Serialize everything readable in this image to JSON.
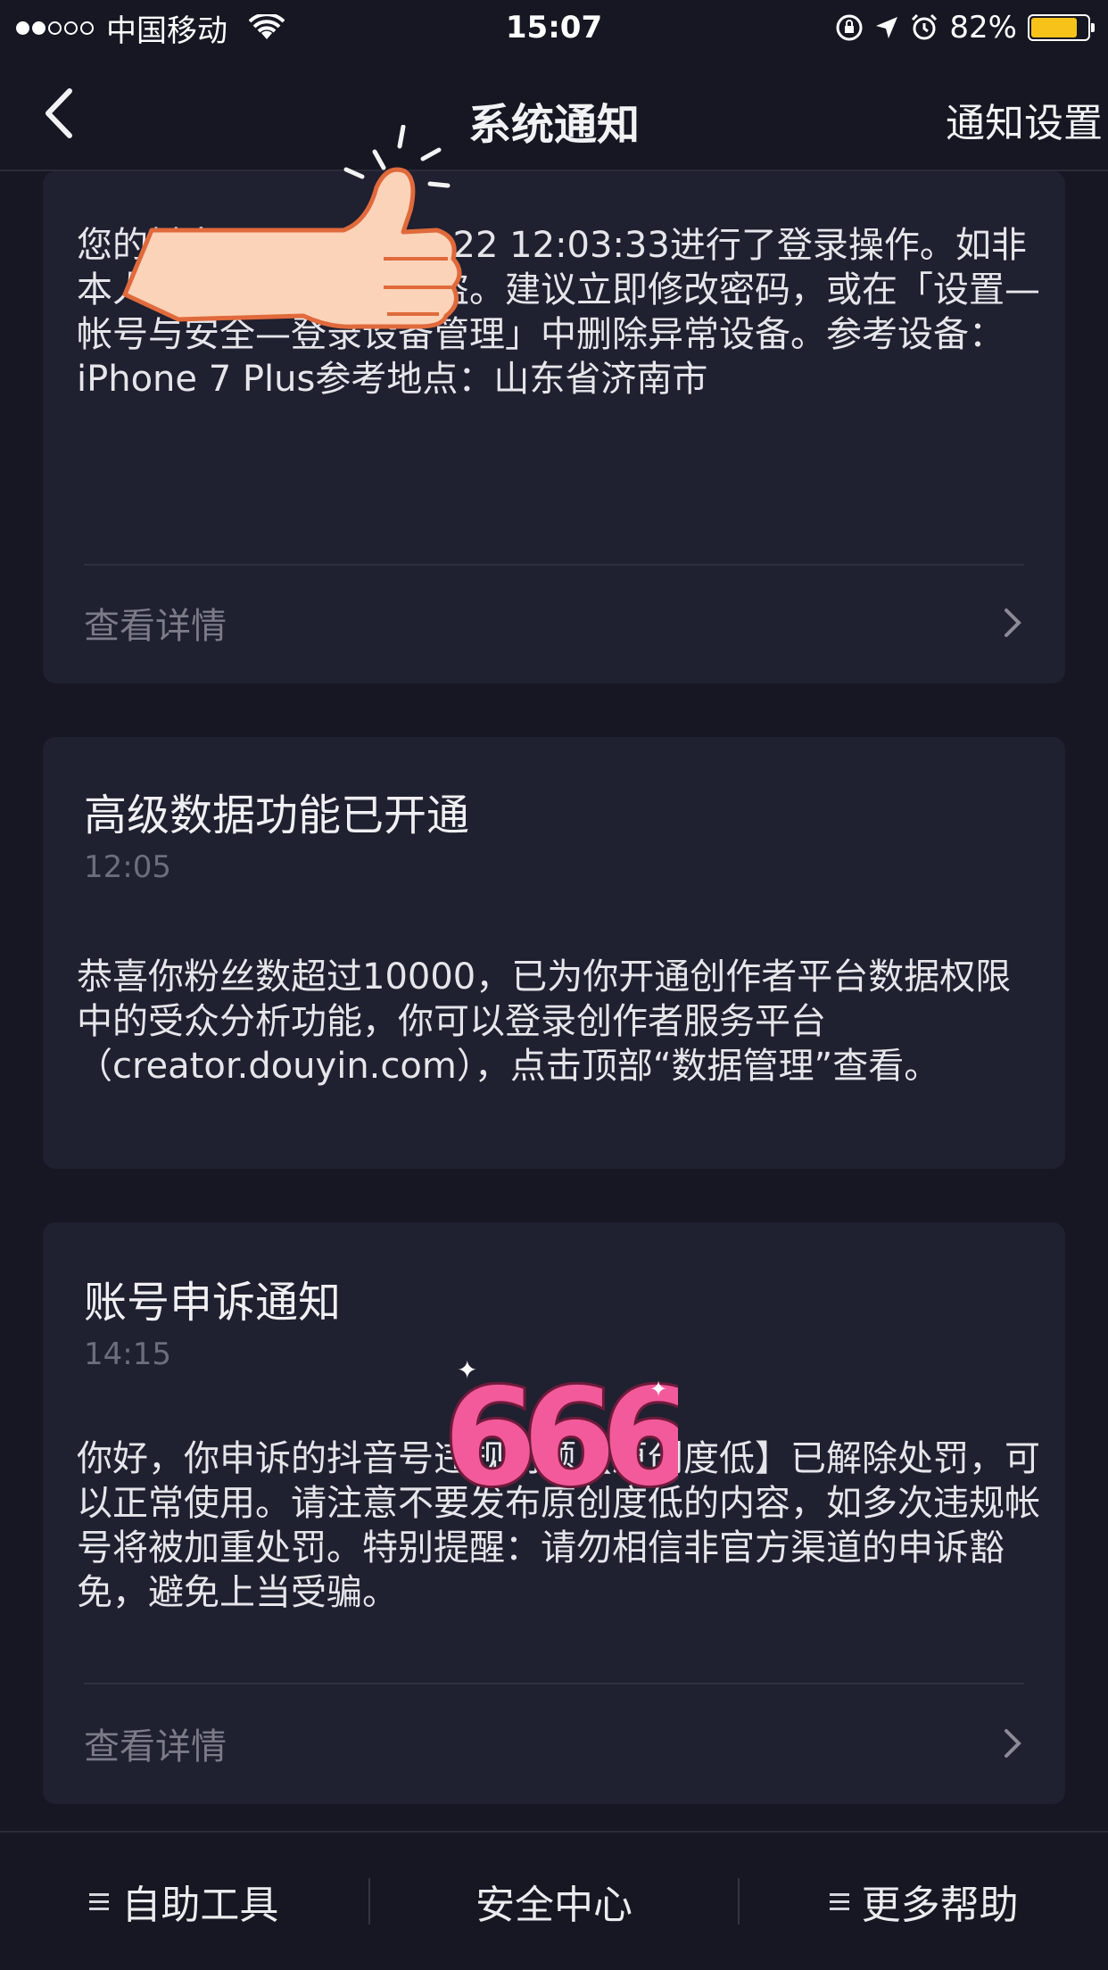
{
  "status_bar": {
    "carrier": "中国移动",
    "time": "15:07",
    "battery": "82%",
    "battery_level": 0.82,
    "battery_color": "#f7c31b"
  },
  "nav": {
    "title": "系统通知",
    "right_action": "通知设置"
  },
  "cards": [
    {
      "body": "您的抖音号于2021-02-22 12:03:33进行了登录操作。如非本人操作，帐号可能被盗。建议立即修改密码，或在「设置—帐号与安全—登录设备管理」中删除异常设备。参考设备：iPhone 7 Plus参考地点：山东省济南市",
      "link": "查看详情"
    },
    {
      "title": "高级数据功能已开通",
      "time": "12:05",
      "body": "恭喜你粉丝数超过10000，已为你开通创作者平台数据权限中的受众分析功能，你可以登录创作者服务平台（creator.douyin.com），点击顶部“数据管理”查看。"
    },
    {
      "title": "账号申诉通知",
      "time": "14:15",
      "body": "你好，你申诉的抖音号违规问题【原创度低】已解除处罚，可以正常使用。请注意不要发布原创度低的内容，如多次违规帐号将被加重处罚。特别提醒：请勿相信非官方渠道的申诉豁免，避免上当受骗。",
      "link": "查看详情"
    }
  ],
  "sticker_666": "666",
  "bottom_bar": {
    "self_service": "自助工具",
    "safety_center": "安全中心",
    "more_help": "更多帮助"
  },
  "icons": {
    "back": "chevron-left-icon",
    "chevron": "chevron-right-icon",
    "menu": "menu-icon",
    "wifi": "wifi-icon",
    "lock_rotation": "rotation-lock-icon",
    "location": "location-arrow-icon",
    "alarm": "alarm-icon"
  }
}
